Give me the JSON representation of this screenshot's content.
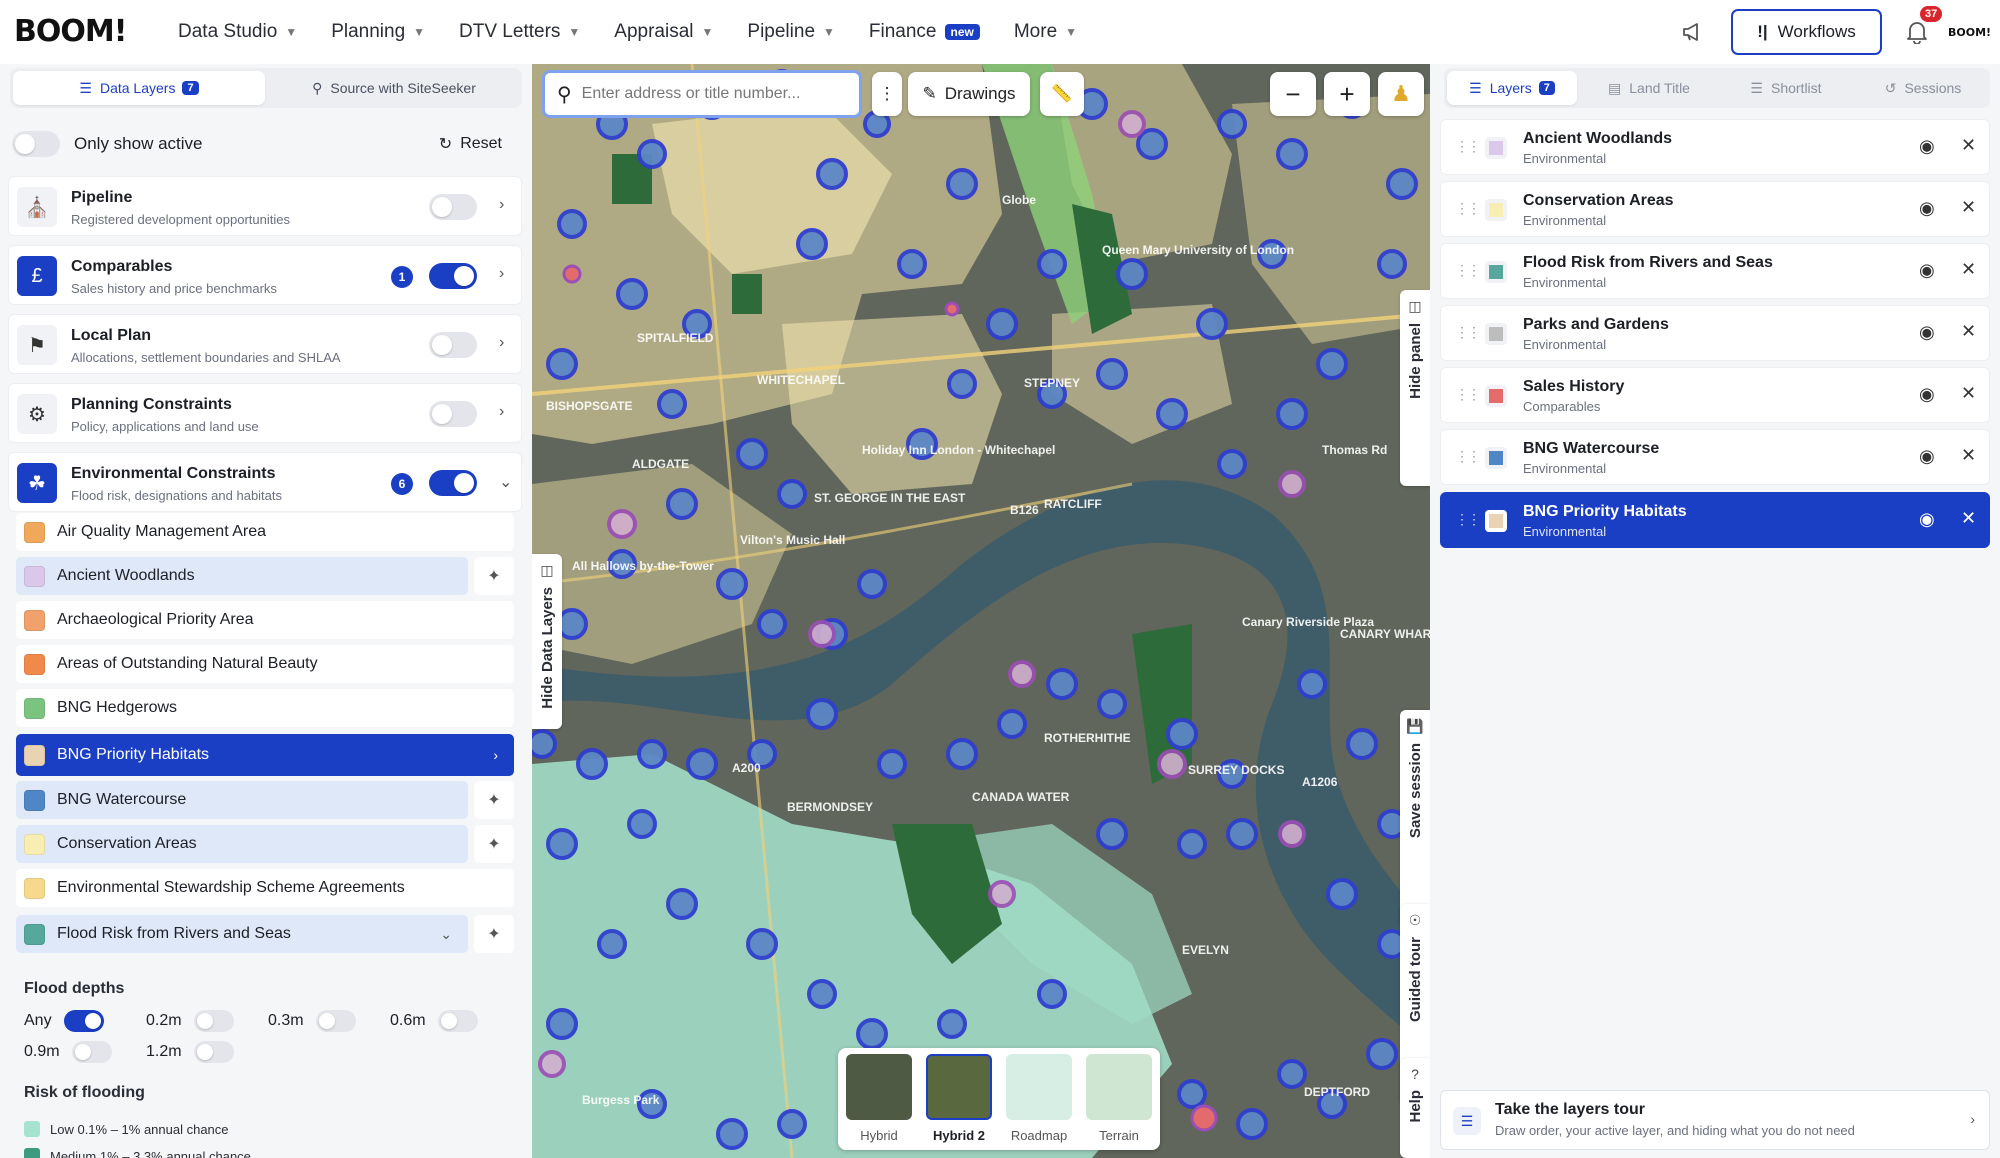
{
  "nav": {
    "logo": "BOOM!",
    "items": [
      {
        "label": "Data Studio",
        "chevron": true
      },
      {
        "label": "Planning",
        "chevron": true
      },
      {
        "label": "DTV Letters",
        "chevron": true
      },
      {
        "label": "Appraisal",
        "chevron": true
      },
      {
        "label": "Pipeline",
        "chevron": true
      },
      {
        "label": "Finance",
        "badge": "new"
      },
      {
        "label": "More",
        "chevron": true
      }
    ],
    "workflows_label": "Workflows",
    "notifications_count": "37",
    "mini_logo": "BOOM!"
  },
  "left": {
    "tabs": [
      {
        "label": "Data Layers",
        "count": "7"
      },
      {
        "label": "Source with SiteSeeker"
      }
    ],
    "only_show_active": "Only show active",
    "reset": "Reset",
    "categories": [
      {
        "title": "Pipeline",
        "subtitle": "Registered development opportunities",
        "on": false
      },
      {
        "title": "Comparables",
        "subtitle": "Sales history and price benchmarks",
        "on": true,
        "count": "1"
      },
      {
        "title": "Local Plan",
        "subtitle": "Allocations, settlement boundaries and SHLAA",
        "on": false
      },
      {
        "title": "Planning Constraints",
        "subtitle": "Policy, applications and land use",
        "on": false
      },
      {
        "title": "Environmental Constraints",
        "subtitle": "Flood risk, designations and habitats",
        "on": true,
        "count": "6"
      }
    ],
    "layers": [
      {
        "label": "Air Quality Management Area",
        "color": "#f0a95b"
      },
      {
        "label": "Ancient Woodlands",
        "color": "#d9c8ea"
      },
      {
        "label": "Archaeological Priority Area",
        "color": "#f0a16c"
      },
      {
        "label": "Areas of Outstanding Natural Beauty",
        "color": "#f08a4a"
      },
      {
        "label": "BNG Hedgerows",
        "color": "#7bc47f"
      },
      {
        "label": "BNG Priority Habitats",
        "color": "#e9d3b2"
      },
      {
        "label": "BNG Watercourse",
        "color": "#4e86c6"
      },
      {
        "label": "Conservation Areas",
        "color": "#f8edb3"
      },
      {
        "label": "Environmental Stewardship Scheme Agreements",
        "color": "#f7d98d"
      },
      {
        "label": "Flood Risk from Rivers and Seas",
        "color": "#56a79c"
      }
    ],
    "flood_depths_title": "Flood depths",
    "depths": [
      {
        "label": "Any",
        "on": true
      },
      {
        "label": "0.2m",
        "on": false
      },
      {
        "label": "0.3m",
        "on": false
      },
      {
        "label": "0.6m",
        "on": false
      },
      {
        "label": "0.9m",
        "on": false
      },
      {
        "label": "1.2m",
        "on": false
      }
    ],
    "risk_title": "Risk of flooding",
    "risks": [
      {
        "label": "Low 0.1% – 1% annual chance",
        "color": "#a6e3cf"
      },
      {
        "label": "Medium 1% – 3.3% annual chance",
        "color": "#3f9b80"
      }
    ]
  },
  "map": {
    "search_placeholder": "Enter address or title number...",
    "drawings": "Drawings",
    "hide_data_layers": "Hide Data Layers",
    "hide_panel": "Hide panel",
    "save_session": "Save session",
    "guided_tour": "Guided tour",
    "help": "Help",
    "basemaps": [
      {
        "label": "Hybrid",
        "active": false,
        "color": "#4f5a45"
      },
      {
        "label": "Hybrid 2",
        "active": true,
        "color": "#5a6840"
      },
      {
        "label": "Roadmap",
        "active": false,
        "color": "#d6eee3"
      },
      {
        "label": "Terrain",
        "active": false,
        "color": "#cfe6d3"
      }
    ],
    "labels": [
      "SPITALFIELD",
      "WHITECHAPEL",
      "BISHOPSGATE",
      "ALDGATE",
      "ST. GEORGE IN THE EAST",
      "STEPNEY",
      "RATCLIFF",
      "BERMONDSEY",
      "CANADA WATER",
      "ROTHERHITHE",
      "Canary Riverside Plaza",
      "CANARY WHARF",
      "Thomas Rd",
      "Burgess Park",
      "DEPTFORD",
      "EVELYN",
      "SURREY DOCKS",
      "Vilton's Music Hall",
      "All Hallows by-the-Tower",
      "B126",
      "A1206",
      "A200",
      "Globe",
      "Queen Mary University of London",
      "Holiday Inn London - Whitechapel"
    ]
  },
  "right": {
    "tabs": [
      {
        "label": "Layers",
        "count": "7",
        "active": true
      },
      {
        "label": "Land Title"
      },
      {
        "label": "Shortlist"
      },
      {
        "label": "Sessions"
      }
    ],
    "layers": [
      {
        "title": "Ancient Woodlands",
        "subtitle": "Environmental",
        "color": "#d9c8ea"
      },
      {
        "title": "Conservation Areas",
        "subtitle": "Environmental",
        "color": "#f8edb3"
      },
      {
        "title": "Flood Risk from Rivers and Seas",
        "subtitle": "Environmental",
        "color": "#56a79c"
      },
      {
        "title": "Parks and Gardens",
        "subtitle": "Environmental",
        "color": "#bdbdbd"
      },
      {
        "title": "Sales History",
        "subtitle": "Comparables",
        "color": "#e36b6b"
      },
      {
        "title": "BNG Watercourse",
        "subtitle": "Environmental",
        "color": "#4e86c6"
      },
      {
        "title": "BNG Priority Habitats",
        "subtitle": "Environmental",
        "color": "#e9d3b2"
      }
    ],
    "tour_title": "Take the layers tour",
    "tour_subtitle": "Draw order, your active layer, and hiding what you do not need"
  }
}
